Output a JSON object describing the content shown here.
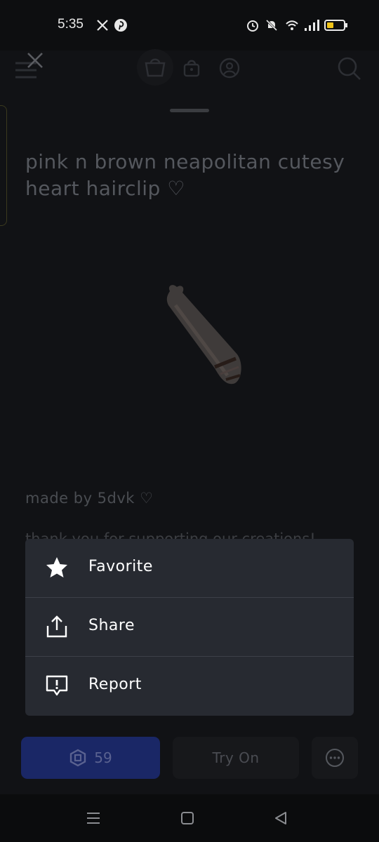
{
  "status_bar": {
    "time": "5:35",
    "icons": [
      "x-icon",
      "pinterest-icon",
      "alarm-icon",
      "muted-bell-icon",
      "wifi-icon",
      "signal-icon",
      "battery-icon"
    ]
  },
  "header": {
    "icons": [
      "close-icon",
      "menu-icon",
      "shopping-bag-icon",
      "lock-bag-icon",
      "avatar-icon",
      "search-icon"
    ]
  },
  "item": {
    "title": "pink n brown neapolitan cutesy heart hairclip ♡",
    "creator": "made by 5dvk ♡",
    "description_peek": "thank you for supporting our creations!"
  },
  "context_menu": {
    "items": [
      {
        "label": "Favorite",
        "icon": "star-icon"
      },
      {
        "label": "Share",
        "icon": "share-icon"
      },
      {
        "label": "Report",
        "icon": "report-icon"
      }
    ]
  },
  "actions": {
    "price": "59",
    "currency_icon": "robux-icon",
    "try_on_label": "Try On",
    "more_icon": "more-icon"
  },
  "nav": {
    "icons": [
      "recents-icon",
      "home-icon",
      "back-icon"
    ]
  },
  "colors": {
    "background": "#111215",
    "menu_background": "#272a31",
    "buy_button": "#1a2766"
  }
}
